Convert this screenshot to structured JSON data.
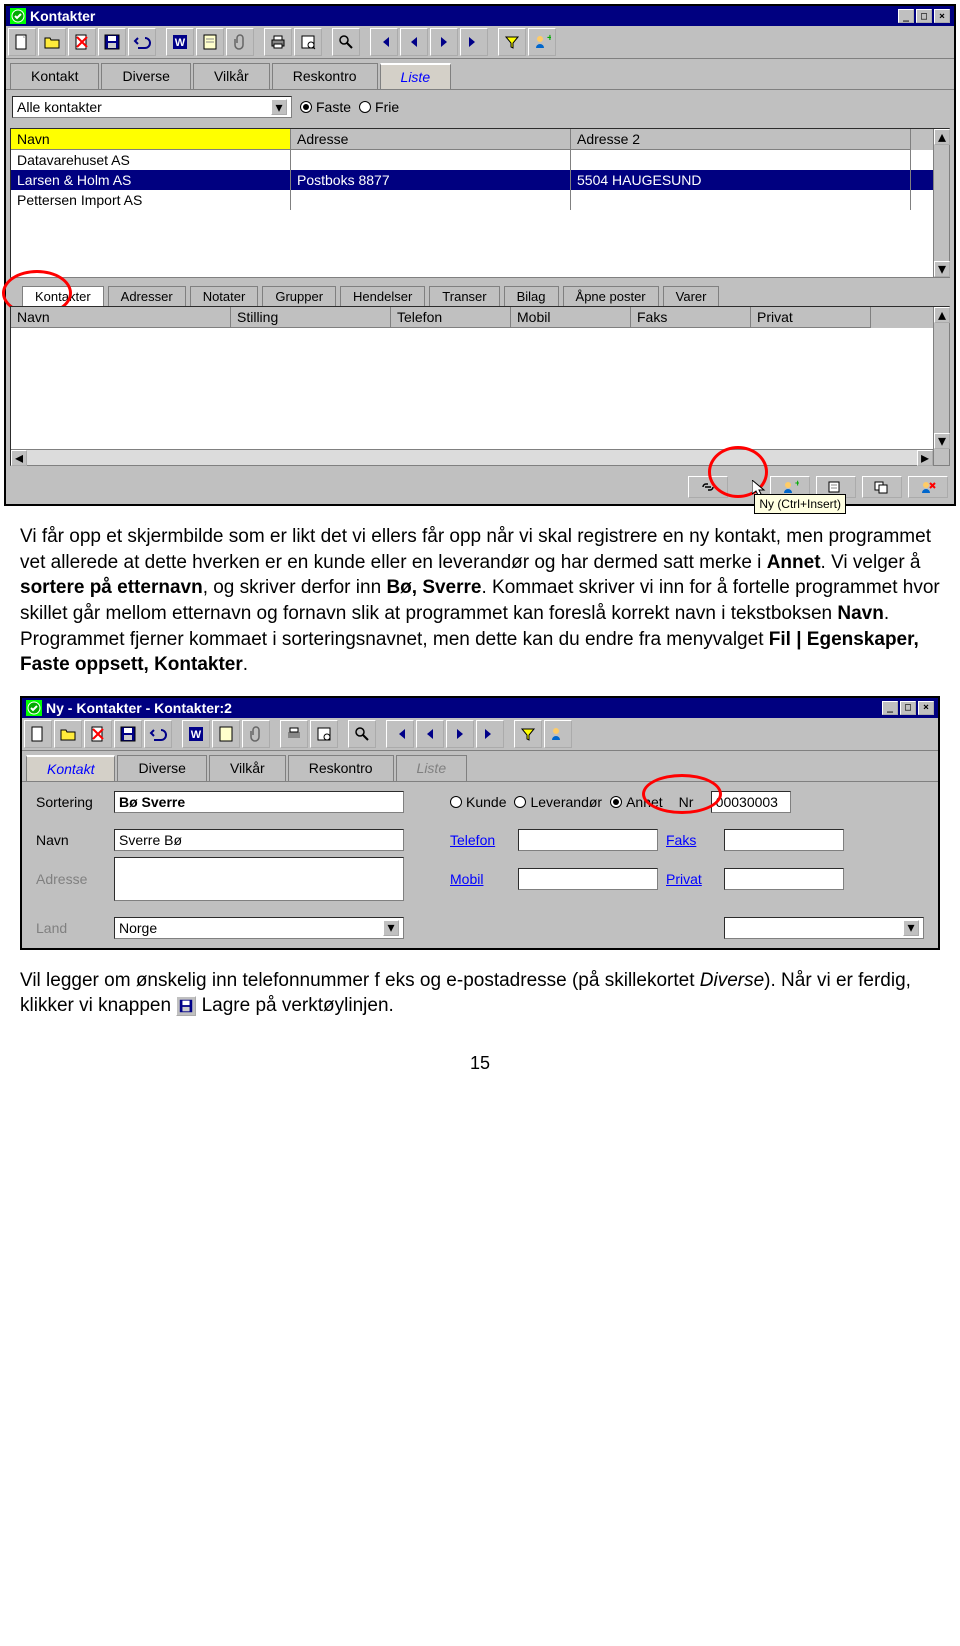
{
  "window1": {
    "title": "Kontakter",
    "tabs": [
      "Kontakt",
      "Diverse",
      "Vilkår",
      "Reskontro",
      "Liste"
    ],
    "filter_dropdown": "Alle kontakter",
    "radio1": "Faste",
    "radio2": "Frie",
    "grid_headers": [
      "Navn",
      "Adresse",
      "Adresse 2"
    ],
    "grid_rows": [
      {
        "cells": [
          "Datavarehuset AS",
          "",
          ""
        ]
      },
      {
        "cells": [
          "Larsen & Holm AS",
          "Postboks 8877",
          "5504 HAUGESUND"
        ],
        "selected": true
      },
      {
        "cells": [
          "Pettersen Import AS",
          "",
          ""
        ]
      }
    ],
    "subtabs": [
      "Kontakter",
      "Adresser",
      "Notater",
      "Grupper",
      "Hendelser",
      "Transer",
      "Bilag",
      "Åpne poster",
      "Varer"
    ],
    "grid2_headers": [
      "Navn",
      "Stilling",
      "Telefon",
      "Mobil",
      "Faks",
      "Privat"
    ],
    "tooltip": "Ny (Ctrl+Insert)"
  },
  "paragraph1": {
    "p1a": "Vi får opp et skjermbilde som er likt det vi ellers får opp når vi skal registrere en ny kontakt, men programmet vet allerede at dette hverken er en kunde eller en leverandør og har dermed satt merke i ",
    "p1b": "Annet",
    "p1c": ". Vi velger å ",
    "p1d": "sortere på etternavn",
    "p1e": ", og skriver derfor inn ",
    "p1f": "Bø, Sverre",
    "p1g": ". Kommaet skriver vi inn for å fortelle programmet hvor skillet går mellom etternavn og fornavn slik at programmet kan foreslå korrekt navn i tekstboksen ",
    "p1h": "Navn",
    "p1i": ". Programmet fjerner kommaet i sorteringsnavnet, men dette kan du endre fra menyvalget ",
    "p1j": "Fil | Egenskaper, Faste oppsett, Kontakter",
    "p1k": "."
  },
  "window2": {
    "title": "Ny - Kontakter - Kontakter:2",
    "tabs": [
      "Kontakt",
      "Diverse",
      "Vilkår",
      "Reskontro",
      "Liste"
    ],
    "labels": {
      "sortering": "Sortering",
      "navn": "Navn",
      "adresse": "Adresse",
      "land": "Land",
      "telefon": "Telefon",
      "mobil": "Mobil",
      "faks": "Faks",
      "privat": "Privat",
      "nr": "Nr"
    },
    "radios": {
      "kunde": "Kunde",
      "leverandor": "Leverandør",
      "annet": "Annet"
    },
    "values": {
      "sortering": "Bø Sverre",
      "navn": "Sverre Bø",
      "land": "Norge",
      "nr": "00030003"
    }
  },
  "paragraph2": {
    "a": "Vil legger om ønskelig inn telefonnummer f eks og e-postadresse (på skillekortet ",
    "b": "Diverse",
    "c": "). Når vi er ferdig, klikker vi knappen ",
    "d": " Lagre på verktøylinjen."
  },
  "page_num": "15"
}
